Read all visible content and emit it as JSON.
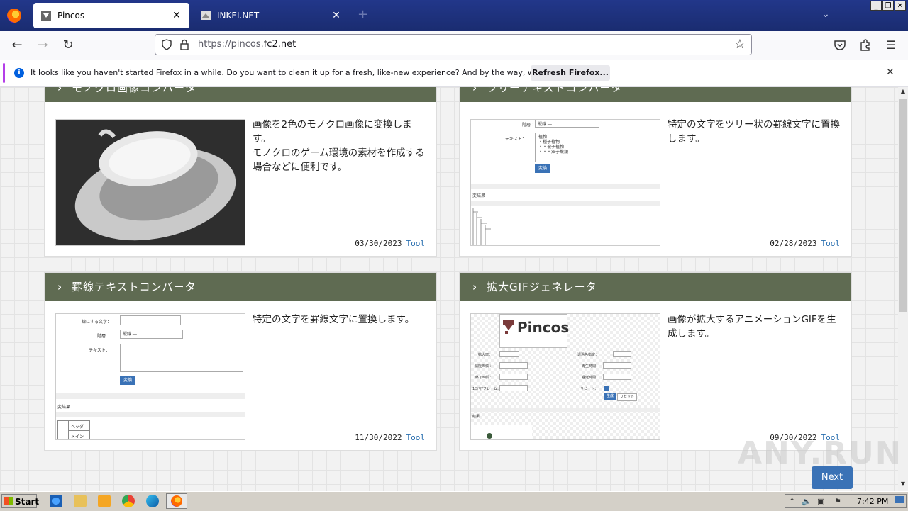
{
  "browser": {
    "tabs": [
      {
        "title": "Pincos",
        "active": true
      },
      {
        "title": "INKEI.NET",
        "active": false
      }
    ],
    "url_prefix": "https://pincos.",
    "url_domain": "fc2.net",
    "window_controls": [
      "_",
      "❐",
      "✕"
    ]
  },
  "notification": {
    "message": "It looks like you haven't started Firefox in a while. Do you want to clean it up for a fresh, like-new experience? And by the way, welcome back!",
    "button": "Refresh Firefox..."
  },
  "cards": [
    {
      "title": "モノクロ画像コンバータ",
      "desc": "画像を2色のモノクロ画像に変換します。\nモノクロのゲーム環境の素材を作成する場合などに便利です。",
      "date": "03/30/2023",
      "tag": "Tool"
    },
    {
      "title": "ツリーテキストコンバータ",
      "desc": "特定の文字をツリー状の罫線文字に置換します。",
      "date": "02/28/2023",
      "tag": "Tool",
      "thumb": {
        "label1": "階層 ：",
        "select": "縦線 ―",
        "label2": "テキスト：",
        "items": [
          "植物",
          "・種子植物",
          "・・被子植物",
          "・・・双子葉類"
        ],
        "btn": "変換",
        "result": "変結果"
      }
    },
    {
      "title": "罫線テキストコンバータ",
      "desc": "特定の文字を罫線文字に置換します。",
      "date": "11/30/2022",
      "tag": "Tool",
      "thumb": {
        "label0": "線にする文字：",
        "label1": "階層 ：",
        "select": "縦線 ―",
        "label2": "テキスト：",
        "btn": "変換",
        "result": "変結果",
        "cell1": "ヘッダ",
        "cell2": "メイン"
      }
    },
    {
      "title": "拡大GIFジェネレータ",
      "desc": "画像が拡大するアニメーションGIFを生成します。",
      "date": "09/30/2022",
      "tag": "Tool",
      "thumb": {
        "logo": "Pincos",
        "fields": [
          "拡大率：",
          "開始時間：",
          "終了時間：",
          "1コマ/フレーム："
        ],
        "fields_right": [
          "透過色指定：",
          "再生時間：",
          "遅延時間：",
          "リピート："
        ],
        "btn": "生成",
        "btn2": "リセット",
        "result": "結果"
      }
    }
  ],
  "next_label": "Next",
  "watermark": "ANY.RUN",
  "taskbar": {
    "start": "Start",
    "time": "7:42 PM"
  }
}
